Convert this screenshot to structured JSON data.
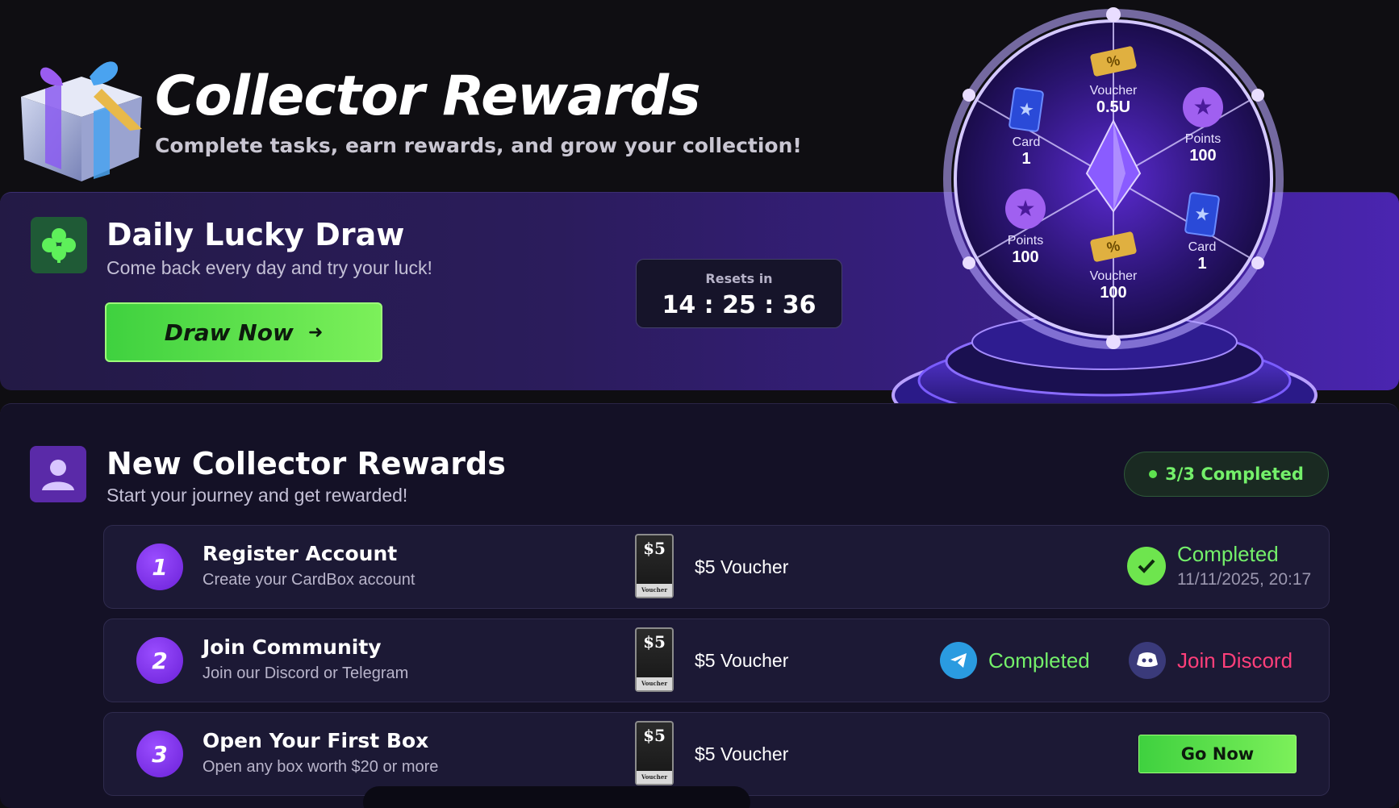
{
  "header": {
    "title": "Collector Rewards",
    "subtitle": "Complete tasks, earn rewards, and grow your collection!"
  },
  "daily_draw": {
    "title": "Daily Lucky Draw",
    "subtitle": "Come back every day and try your luck!",
    "button_label": "Draw Now",
    "resets_label": "Resets in",
    "resets_time": "14 : 25 : 36"
  },
  "wheel": {
    "segments": [
      {
        "label": "Voucher",
        "value": "0.5U",
        "icon": "voucher-icon"
      },
      {
        "label": "Points",
        "value": "100",
        "icon": "points-star-icon"
      },
      {
        "label": "Card",
        "value": "1",
        "icon": "card-icon"
      },
      {
        "label": "Voucher",
        "value": "100",
        "icon": "voucher-icon"
      },
      {
        "label": "Points",
        "value": "100",
        "icon": "points-star-icon"
      },
      {
        "label": "Card",
        "value": "1",
        "icon": "card-icon"
      }
    ]
  },
  "new_collector": {
    "title": "New Collector Rewards",
    "subtitle": "Start your journey and get rewarded!",
    "progress_label": "3/3 Completed",
    "tasks": [
      {
        "number": "1",
        "title": "Register Account",
        "description": "Create your CardBox account",
        "reward": "$5 Voucher",
        "status": "Completed",
        "timestamp": "11/11/2025, 20:17"
      },
      {
        "number": "2",
        "title": "Join Community",
        "description": "Join our Discord or Telegram",
        "reward": "$5 Voucher",
        "telegram_status": "Completed",
        "discord_action": "Join Discord"
      },
      {
        "number": "3",
        "title": "Open Your First Box",
        "description": "Open any box worth $20 or more",
        "reward": "$5 Voucher",
        "action": "Go Now"
      }
    ],
    "voucher_badge": {
      "amount": "$5",
      "footer": "Voucher"
    }
  },
  "colors": {
    "accent_green": "#6ee54e",
    "accent_purple": "#7b2cf0",
    "discord_pink": "#ff3f7a",
    "telegram_blue": "#2a9be0"
  }
}
